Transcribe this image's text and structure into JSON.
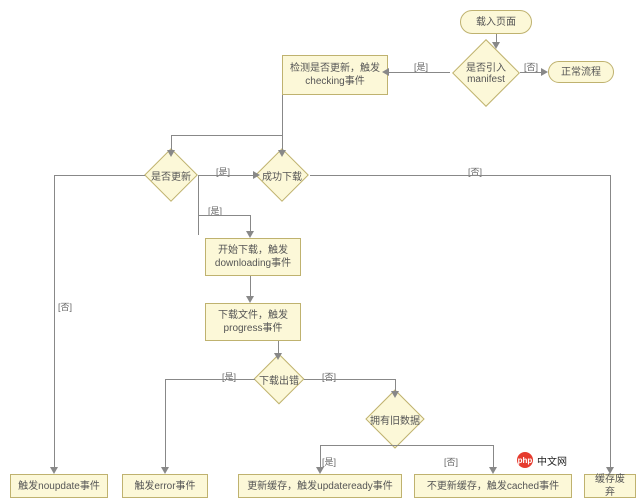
{
  "chart_data": {
    "type": "flowchart",
    "title": "",
    "nodes": [
      {
        "id": "start",
        "type": "terminator",
        "label": "载入页面"
      },
      {
        "id": "q_manifest",
        "type": "decision",
        "label": "是否引入\nmanifest"
      },
      {
        "id": "normal",
        "type": "terminator",
        "label": "正常流程"
      },
      {
        "id": "checking",
        "type": "process",
        "label": "检测是否更新，触\n发checking事件"
      },
      {
        "id": "q_update",
        "type": "decision",
        "label": "是否更新"
      },
      {
        "id": "q_dlsuccess",
        "type": "decision",
        "label": "成功下载"
      },
      {
        "id": "downloading",
        "type": "process",
        "label": "开始下载，触发\ndownloading事件"
      },
      {
        "id": "progress",
        "type": "process",
        "label": "下载文件，触发\nprogress事件"
      },
      {
        "id": "q_dlerr",
        "type": "decision",
        "label": "下载出错"
      },
      {
        "id": "q_olddata",
        "type": "decision",
        "label": "拥有旧数据"
      },
      {
        "id": "noupdate",
        "type": "process",
        "label": "触发noupdate事件"
      },
      {
        "id": "error",
        "type": "process",
        "label": "触发error事件"
      },
      {
        "id": "updateready",
        "type": "process",
        "label": "更新缓存，触发updateready事件"
      },
      {
        "id": "cached",
        "type": "process",
        "label": "不更新缓存，触发cached事件"
      },
      {
        "id": "obsolete",
        "type": "process",
        "label": "缓存废弃"
      }
    ],
    "edges": [
      {
        "from": "start",
        "to": "q_manifest"
      },
      {
        "from": "q_manifest",
        "to": "normal",
        "label": "否"
      },
      {
        "from": "q_manifest",
        "to": "checking",
        "label": "是"
      },
      {
        "from": "checking",
        "to": "q_update"
      },
      {
        "from": "q_update",
        "to": "noupdate",
        "label": "否"
      },
      {
        "from": "q_update",
        "to": "q_dlsuccess",
        "label": "是"
      },
      {
        "from": "q_dlsuccess",
        "to": "obsolete",
        "label": "否"
      },
      {
        "from": "q_dlsuccess",
        "to": "downloading",
        "label": "是"
      },
      {
        "from": "downloading",
        "to": "progress"
      },
      {
        "from": "progress",
        "to": "q_dlerr"
      },
      {
        "from": "q_dlerr",
        "to": "error",
        "label": "是"
      },
      {
        "from": "q_dlerr",
        "to": "q_olddata",
        "label": "否"
      },
      {
        "from": "q_olddata",
        "to": "updateready",
        "label": "是"
      },
      {
        "from": "q_olddata",
        "to": "cached",
        "label": "否"
      }
    ]
  },
  "nodes": {
    "start": "载入页面",
    "q_manifest": "是否引入manifest",
    "normal": "正常流程",
    "checking": "检测是否更新，触发checking事件",
    "q_update": "是否更新",
    "q_dlsuccess": "成功下载",
    "downloading": "开始下载，触发downloading事件",
    "progress": "下载文件，触发progress事件",
    "q_dlerr": "下载出错",
    "q_olddata": "拥有旧数据",
    "noupdate": "触发noupdate事件",
    "error": "触发error事件",
    "updateready": "更新缓存，触发updateready事件",
    "cached": "不更新缓存，触发cached事件",
    "obsolete": "缓存废弃"
  },
  "labels": {
    "yes": "[是]",
    "no": "[否]"
  },
  "watermark": {
    "dot": "php",
    "text": "中文网"
  }
}
